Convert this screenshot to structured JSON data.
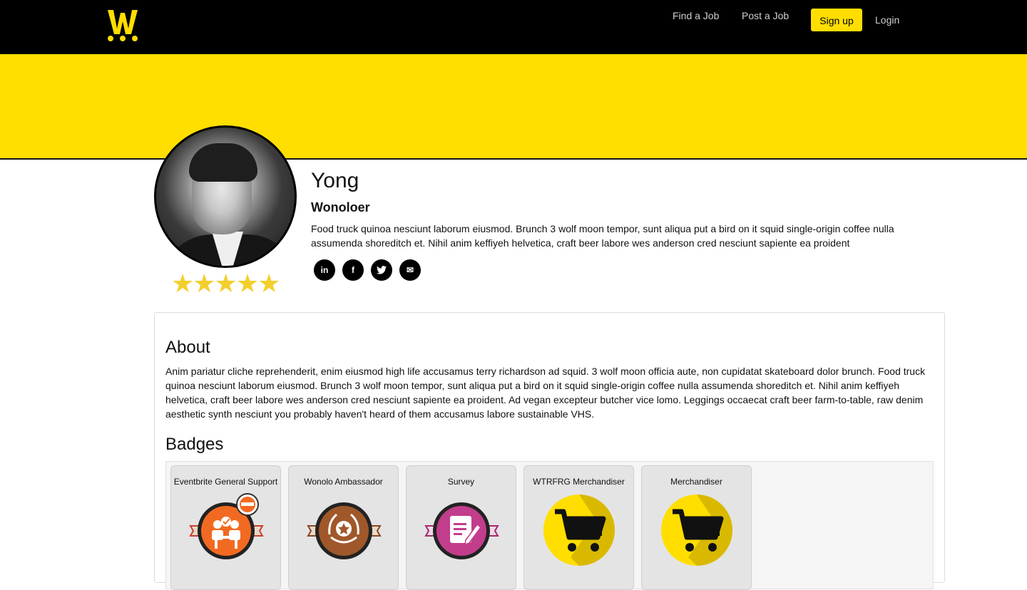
{
  "nav": {
    "logo_text": "W",
    "find_job": "Find a Job",
    "post_job": "Post a Job",
    "signup": "Sign up",
    "login": "Login"
  },
  "colors": {
    "brand_yellow": "#ffde00",
    "star": "#f3cf2d",
    "topbar": "#000000"
  },
  "profile": {
    "name": "Yong",
    "role": "Wonoloer",
    "bio": "Food truck quinoa nesciunt laborum eiusmod. Brunch 3 wolf moon tempor, sunt aliqua put a bird on it squid single-origin coffee nulla assumenda shoreditch et. Nihil anim keffiyeh helvetica, craft beer labore wes anderson cred nesciunt sapiente ea proident",
    "rating_stars": 5,
    "rating_text": "★★★★★",
    "socials": [
      {
        "icon": "linkedin-icon",
        "glyph": "in"
      },
      {
        "icon": "facebook-icon",
        "glyph": "f"
      },
      {
        "icon": "twitter-icon",
        "glyph": "t"
      },
      {
        "icon": "email-icon",
        "glyph": "✉"
      }
    ]
  },
  "about": {
    "title": "About",
    "text": "Anim pariatur cliche reprehenderit, enim eiusmod high life accusamus terry richardson ad squid. 3 wolf moon officia aute, non cupidatat skateboard dolor brunch. Food truck quinoa nesciunt laborum eiusmod. Brunch 3 wolf moon tempor, sunt aliqua put a bird on it squid single-origin coffee nulla assumenda shoreditch et. Nihil anim keffiyeh helvetica, craft beer labore wes anderson cred nesciunt sapiente ea proident. Ad vegan excepteur butcher vice lomo. Leggings occaecat craft beer farm-to-table, raw denim aesthetic synth nesciunt you probably haven't heard of them accusamus labore sustainable VHS."
  },
  "badges": {
    "title": "Badges",
    "items": [
      {
        "label": "Eventbrite General Support",
        "icon": "support-badge-icon",
        "color": "#f26a22"
      },
      {
        "label": "Wonolo Ambassador",
        "icon": "ambassador-badge-icon",
        "color": "#a0582a"
      },
      {
        "label": "Survey",
        "icon": "survey-badge-icon",
        "color": "#c23d8c"
      },
      {
        "label": "WTRFRG Merchandiser",
        "icon": "cart-icon",
        "color": "#ffde00"
      },
      {
        "label": "Merchandiser",
        "icon": "cart-icon",
        "color": "#ffde00"
      }
    ]
  }
}
